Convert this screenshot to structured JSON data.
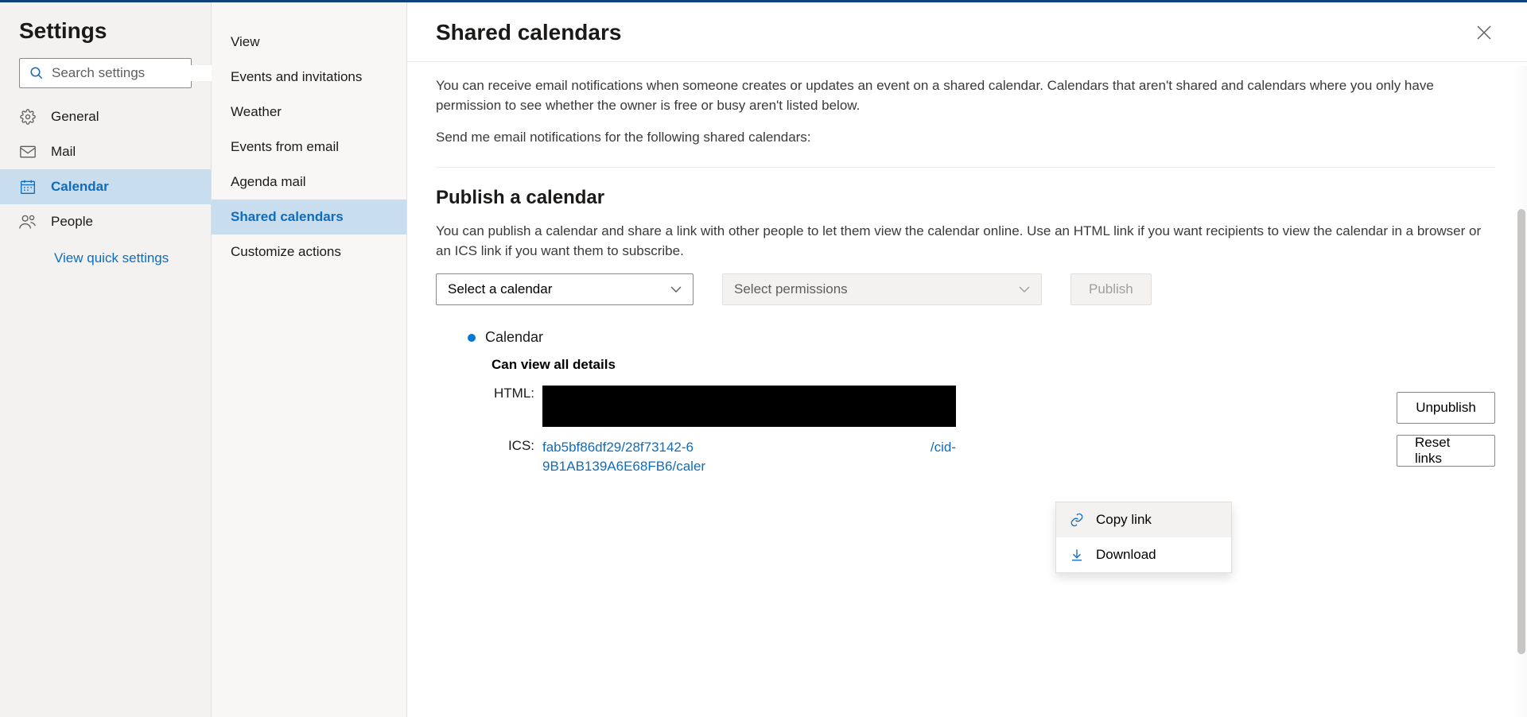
{
  "col1": {
    "title": "Settings",
    "search_placeholder": "Search settings",
    "items": [
      {
        "label": "General"
      },
      {
        "label": "Mail"
      },
      {
        "label": "Calendar"
      },
      {
        "label": "People"
      }
    ],
    "quick_link": "View quick settings"
  },
  "col2": {
    "items": [
      {
        "label": "View"
      },
      {
        "label": "Events and invitations"
      },
      {
        "label": "Weather"
      },
      {
        "label": "Events from email"
      },
      {
        "label": "Agenda mail"
      },
      {
        "label": "Shared calendars"
      },
      {
        "label": "Customize actions"
      }
    ]
  },
  "content": {
    "title": "Shared calendars",
    "notif_desc": "You can receive email notifications when someone creates or updates an event on a shared calendar. Calendars that aren't shared and calendars where you only have permission to see whether the owner is free or busy aren't listed below.",
    "notif_prompt": "Send me email notifications for the following shared calendars:",
    "publish_title": "Publish a calendar",
    "publish_desc": "You can publish a calendar and share a link with other people to let them view the calendar online. Use an HTML link if you want recipients to view the calendar in a browser or an ICS link if you want them to subscribe.",
    "select_cal": "Select a calendar",
    "select_perm": "Select permissions",
    "publish_btn": "Publish",
    "calendar_label": "Calendar",
    "perm_text": "Can view all details",
    "html_lbl": "HTML:",
    "ics_lbl": "ICS:",
    "ics_partial_1": "fab5bf86df29/28f73142-6",
    "ics_partial_2": "/cid-",
    "ics_partial_3": "9B1AB139A6E68FB6/caler",
    "unpublish_btn": "Unpublish",
    "reset_btn": "Reset links",
    "cm_copy": "Copy link",
    "cm_download": "Download"
  }
}
